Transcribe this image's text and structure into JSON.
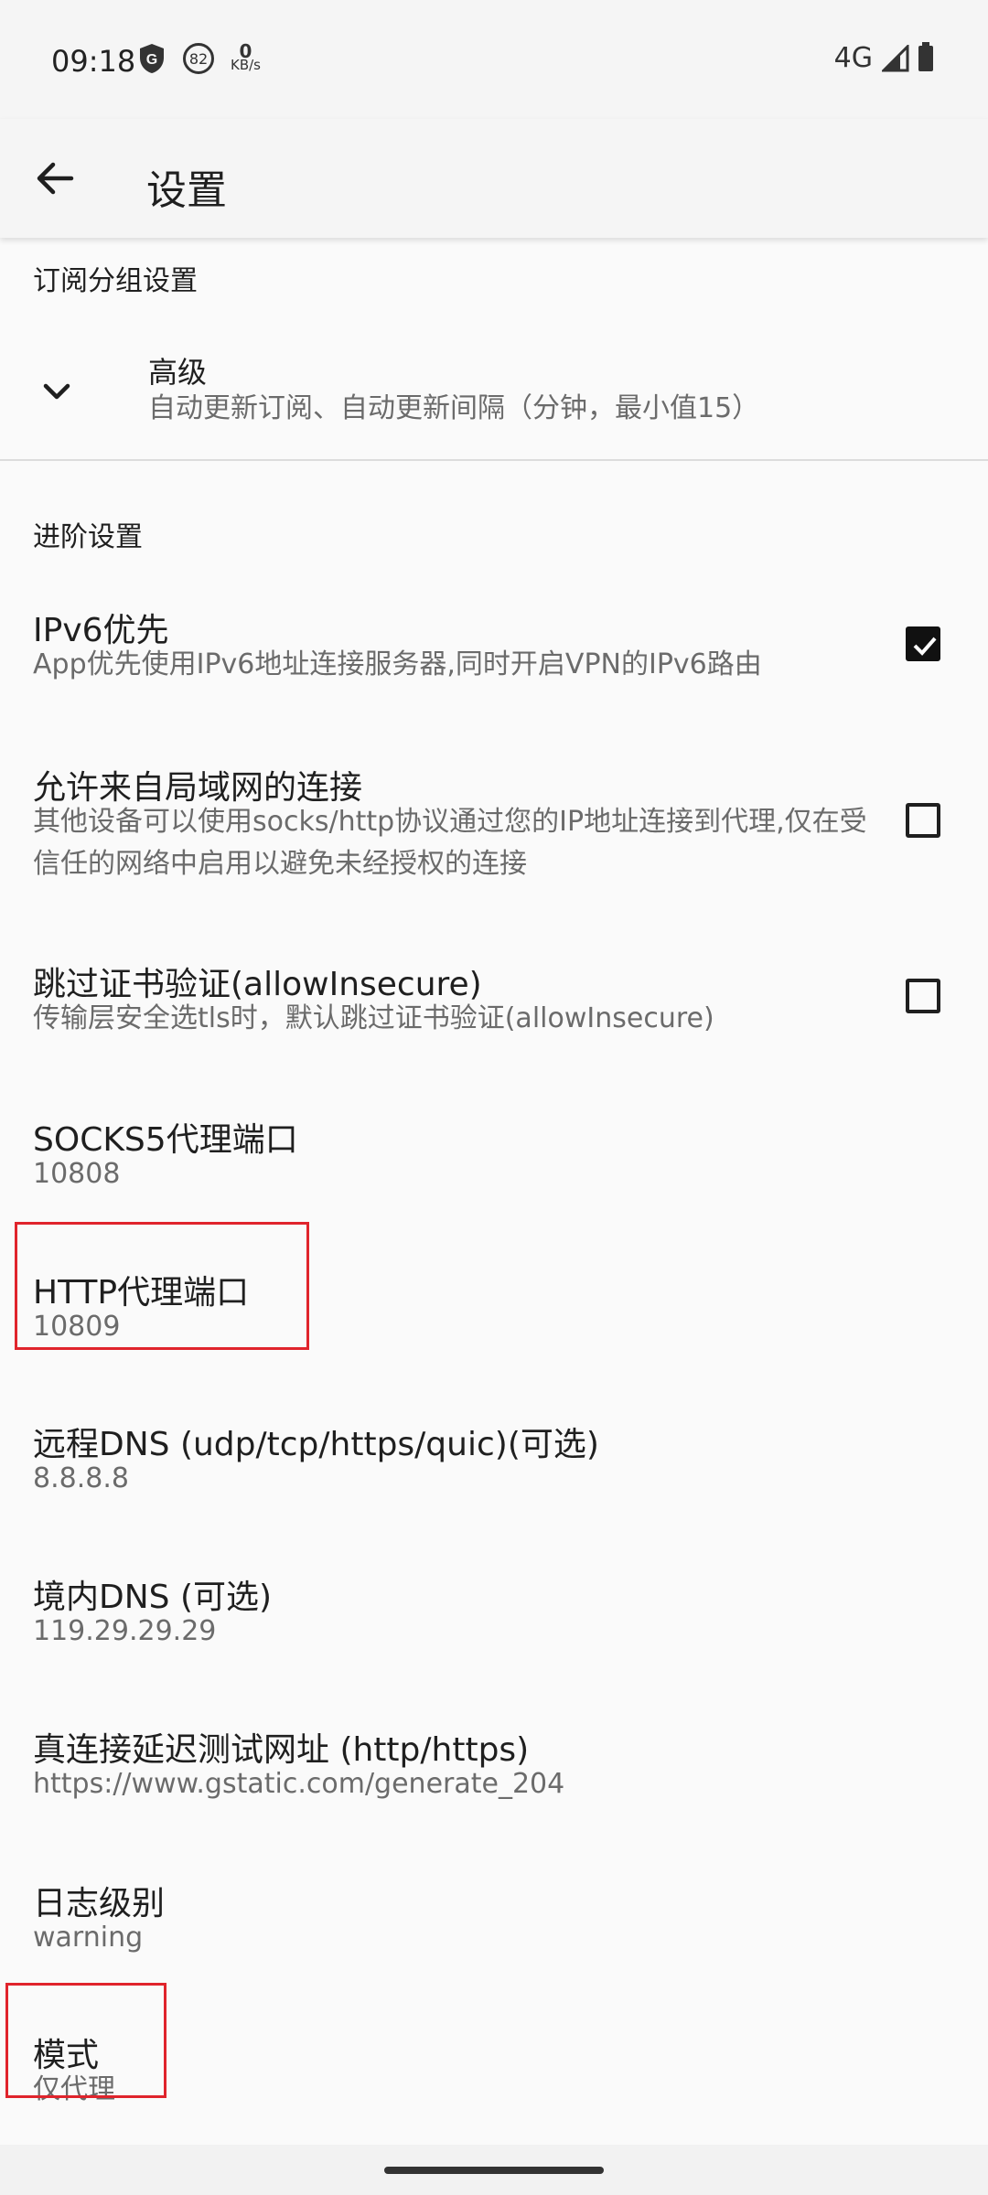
{
  "status_bar": {
    "time": "09:18",
    "badge_number": "82",
    "speed_value": "0",
    "speed_unit": "KB/s",
    "network": "4G"
  },
  "app_bar": {
    "title": "设置"
  },
  "sections": {
    "subscription_group": "订阅分组设置",
    "advanced_expander": {
      "title": "高级",
      "summary": "自动更新订阅、自动更新间隔（分钟，最小值15）"
    },
    "advanced_settings": "进阶设置"
  },
  "prefs": {
    "ipv6": {
      "title": "IPv6优先",
      "summary": "App优先使用IPv6地址连接服务器,同时开启VPN的IPv6路由",
      "checked": true
    },
    "lan": {
      "title": "允许来自局域网的连接",
      "summary": "其他设备可以使用socks/http协议通过您的IP地址连接到代理,仅在受信任的网络中启用以避免未经授权的连接",
      "checked": false
    },
    "insecure": {
      "title": "跳过证书验证(allowInsecure)",
      "summary": "传输层安全选tls时，默认跳过证书验证(allowInsecure)",
      "checked": false
    },
    "socks5": {
      "title": "SOCKS5代理端口",
      "summary": "10808"
    },
    "http": {
      "title": "HTTP代理端口",
      "summary": "10809"
    },
    "remote_dns": {
      "title": "远程DNS (udp/tcp/https/quic)(可选)",
      "summary": "8.8.8.8"
    },
    "domestic_dns": {
      "title": "境内DNS (可选)",
      "summary": "119.29.29.29"
    },
    "delay_url": {
      "title": "真连接延迟测试网址 (http/https)",
      "summary": "https://www.gstatic.com/generate_204"
    },
    "log_level": {
      "title": "日志级别",
      "summary": "warning"
    },
    "mode": {
      "title": "模式",
      "summary": "仅代理"
    }
  },
  "colors": {
    "highlight": "#e0242c",
    "background": "#fafafa",
    "summary_text": "#6b6b6b"
  }
}
